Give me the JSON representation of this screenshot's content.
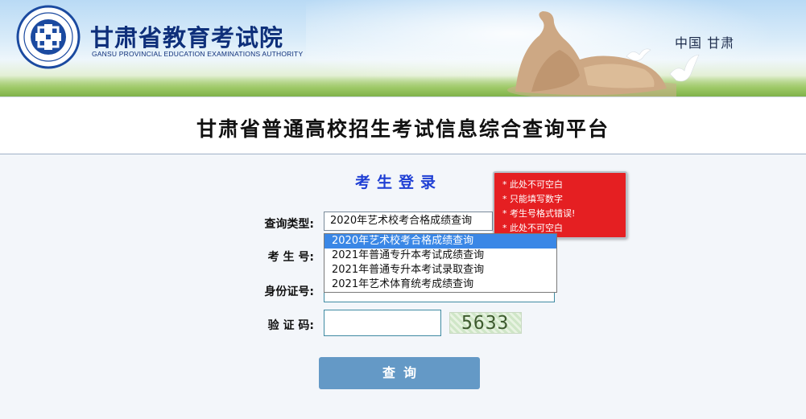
{
  "header": {
    "title_cn": "甘肃省教育考试院",
    "title_en": "GANSU PROVINCIAL EDUCATION EXAMINATIONS AUTHORITY",
    "region": "中国 甘肃",
    "logo_icon": "institution-seal-logo"
  },
  "platform": {
    "title": "甘肃省普通高校招生考试信息综合查询平台"
  },
  "login": {
    "title": "考生登录",
    "fields": {
      "query_type_label": "查询类型:",
      "query_type_value": "2020年艺术校考合格成绩查询",
      "exam_number_label": "考 生 号:",
      "exam_number_value": "",
      "id_number_label": "身份证号:",
      "id_number_value": "",
      "captcha_label": "验 证 码:",
      "captcha_value": "",
      "captcha_image_text": "5633"
    },
    "dropdown_options": [
      "2020年艺术校考合格成绩查询",
      "2021年普通专升本考试成绩查询",
      "2021年普通专升本考试录取查询",
      "2021年艺术体育统考成绩查询"
    ],
    "selected_option_index": 0,
    "errors": [
      "* 此处不可空白",
      "* 只能填写数字",
      "* 考生号格式错误!",
      "* 此处不可空白"
    ],
    "submit_label": "查询"
  },
  "colors": {
    "title_blue": "#0e2f7a",
    "login_title": "#1f3fd4",
    "error_bg": "#e51f22",
    "button_bg": "#6499c6",
    "selected_option": "#3a87e6"
  }
}
